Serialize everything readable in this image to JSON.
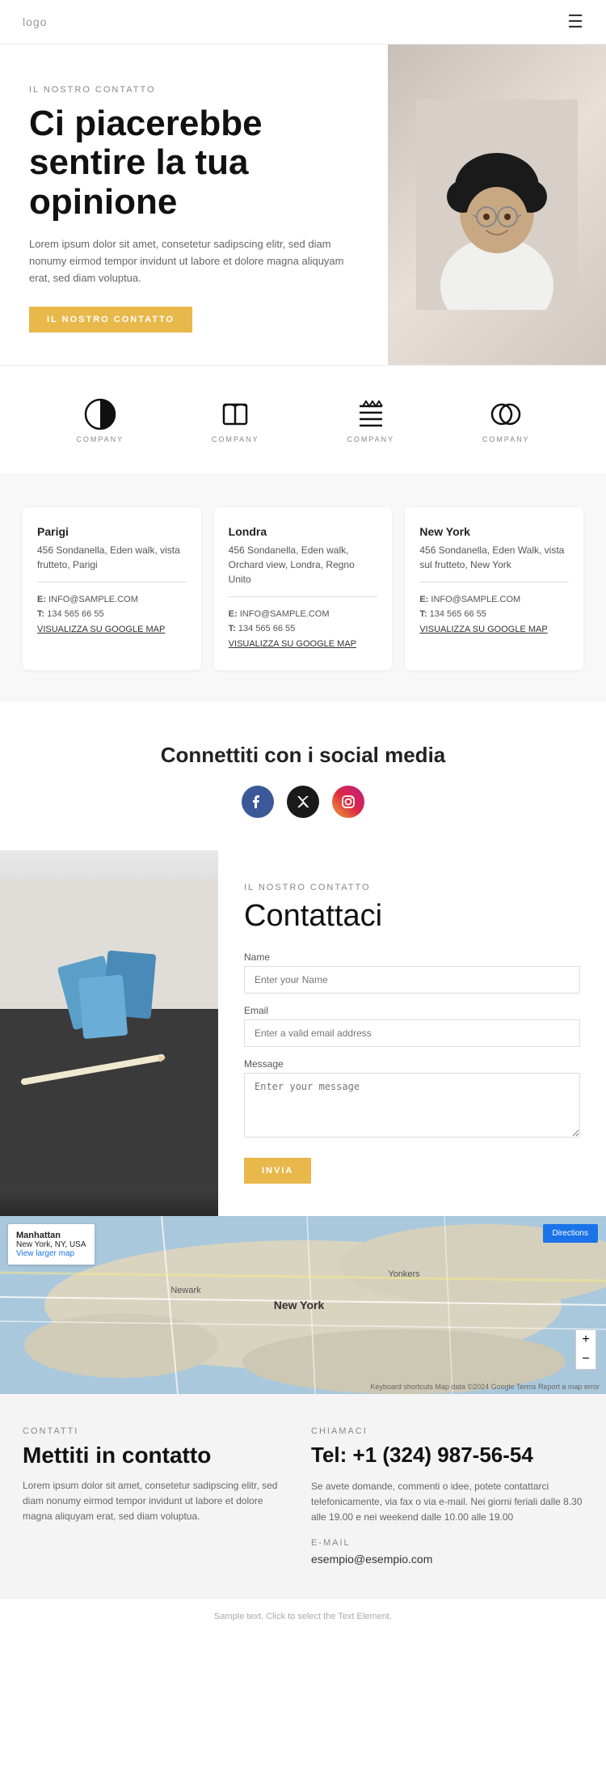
{
  "navbar": {
    "logo": "logo",
    "menu_icon": "≡"
  },
  "hero": {
    "label": "IL NOSTRO CONTATTO",
    "title": "Ci piacerebbe sentire la tua opinione",
    "description": "Lorem ipsum dolor sit amet, consetetur sadipscing elitr, sed diam nonumy eirmod tempor invidunt ut labore et dolore magna aliquyam erat, sed diam voluptua.",
    "button_label": "IL NOSTRO CONTATTO"
  },
  "logos": [
    {
      "text": "COMPANY",
      "shape": "circle-half"
    },
    {
      "text": "COMPANY",
      "shape": "book"
    },
    {
      "text": "COMPANY",
      "shape": "lines"
    },
    {
      "text": "COMPANY",
      "shape": "circle-link"
    }
  ],
  "offices": [
    {
      "city": "Parigi",
      "address": "456 Sondanella, Eden walk, vista frutteto, Parigi",
      "email_label": "E:",
      "email": "INFO@SAMPLE.COM",
      "phone_label": "T:",
      "phone": "134 565 66 55",
      "map_link": "VISUALIZZA SU GOOGLE MAP"
    },
    {
      "city": "Londra",
      "address": "456 Sondanella, Eden walk, Orchard view, Londra, Regno Unito",
      "email_label": "E:",
      "email": "INFO@SAMPLE.COM",
      "phone_label": "T:",
      "phone": "134 565 66 55",
      "map_link": "VISUALIZZA SU GOOGLE MAP"
    },
    {
      "city": "New York",
      "address": "456 Sondanella, Eden Walk, vista sul frutteto, New York",
      "email_label": "E:",
      "email": "INFO@SAMPLE.COM",
      "phone_label": "T:",
      "phone": "134 565 66 55",
      "map_link": "VISUALIZZA SU GOOGLE MAP"
    }
  ],
  "social": {
    "title": "Connettiti con i social media",
    "facebook": "f",
    "twitter": "𝕏",
    "instagram": "📷"
  },
  "contact_form": {
    "label": "IL NOSTRO CONTATTO",
    "title": "Contattaci",
    "name_label": "Name",
    "name_placeholder": "Enter your Name",
    "email_label": "Email",
    "email_placeholder": "Enter a valid email address",
    "message_label": "Message",
    "message_placeholder": "Enter your message",
    "submit_label": "INVIA"
  },
  "map": {
    "location": "Manhattan",
    "sublocation": "New York, NY, USA",
    "view_larger": "View larger map",
    "directions": "Directions",
    "zoom_in": "+",
    "zoom_out": "−",
    "copyright": "Keyboard shortcuts  Map data ©2024 Google  Terms  Report a map error"
  },
  "bottom_contact": {
    "left": {
      "label": "CONTATTI",
      "title": "Mettiti in contatto",
      "description": "Lorem ipsum dolor sit amet, consetetur sadipscing elitr, sed diam nonumy eirmod tempor invidunt ut labore et dolore magna aliquyam erat, sed diam voluptua."
    },
    "right": {
      "call_label": "CHIAMACI",
      "phone": "Tel: +1 (324) 987-56-54",
      "call_description": "Se avete domande, commenti o idee, potete contattarci telefonicamente, via fax o via e-mail. Nei giorni feriali dalle 8.30 alle 19.00 e nei weekend dalle 10.00 alle 19.00",
      "email_label": "E-MAIL",
      "email": "esempio@esempio.com"
    }
  },
  "footer": {
    "text": "Sample text. Click to select the Text Element."
  }
}
